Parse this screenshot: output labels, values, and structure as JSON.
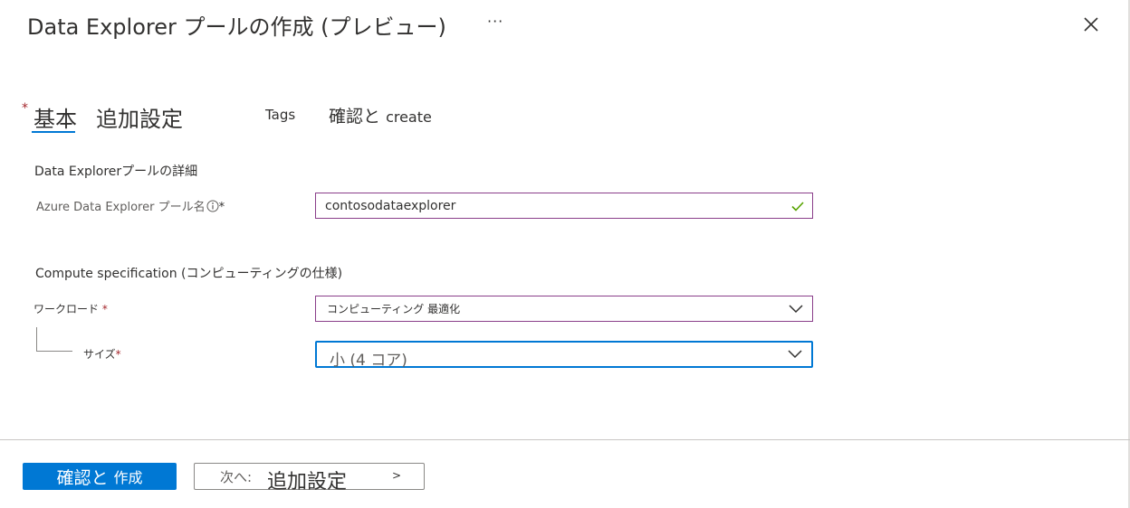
{
  "header": {
    "title": "Data Explorer プールの作成 (プレビュー)",
    "more_label": "···",
    "close_icon": "close-icon"
  },
  "tabs": [
    {
      "label": "基本",
      "required_marker": "*",
      "active": true
    },
    {
      "label": "追加設定"
    },
    {
      "label": "Tags"
    },
    {
      "label_main": "確認と",
      "label_sub": "create"
    }
  ],
  "pool_details": {
    "section_title": "Data Explorerプールの詳細",
    "name_label": "Azure Data Explorer プール名",
    "name_required": "*",
    "name_value": "contosodataexplorer",
    "info_icon": "info-icon",
    "valid_icon": "checkmark-icon"
  },
  "compute": {
    "section_title": "Compute specification (コンピューティングの仕様)",
    "workload_label": "ワークロード",
    "workload_required": "*",
    "workload_value": "コンピューティング 最適化",
    "size_label": "サイズ",
    "size_required": "*",
    "size_value": "小 (4 コア)",
    "dropdown_icon": "chevron-down-icon"
  },
  "footer": {
    "review_main": "確認と",
    "review_sub": "作成",
    "next_prefix": "次へ:",
    "next_target": "追加設定",
    "next_arrow": ">"
  },
  "colors": {
    "accent": "#0078d4",
    "required": "#a4262c",
    "focus_border_purple": "#8a3e8a",
    "valid_check": "#57a300"
  }
}
